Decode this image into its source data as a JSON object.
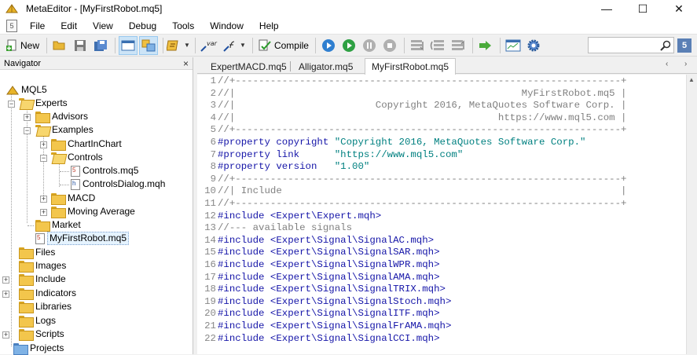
{
  "window": {
    "title": "MetaEditor - [MyFirstRobot.mq5]",
    "controls": [
      "—",
      "☐",
      "✕"
    ]
  },
  "menu": {
    "doc_icon": "5",
    "items": [
      "File",
      "Edit",
      "View",
      "Debug",
      "Tools",
      "Window",
      "Help"
    ]
  },
  "toolbar": {
    "new_label": "New",
    "compile_label": "Compile",
    "var_label": "var",
    "help_label": "5"
  },
  "navigator": {
    "title": "Navigator",
    "close": "×",
    "tree": [
      {
        "label": "MQL5",
        "icon": "mql5-root-icon"
      },
      {
        "label": "Experts",
        "icon": "folder-open-icon"
      },
      {
        "label": "Advisors",
        "icon": "folder-icon"
      },
      {
        "label": "Examples",
        "icon": "folder-open-icon"
      },
      {
        "label": "ChartInChart",
        "icon": "folder-icon"
      },
      {
        "label": "Controls",
        "icon": "folder-open-icon"
      },
      {
        "label": "Controls.mq5",
        "icon": "mq5-file-icon"
      },
      {
        "label": "ControlsDialog.mqh",
        "icon": "mqh-file-icon"
      },
      {
        "label": "MACD",
        "icon": "folder-icon"
      },
      {
        "label": "Moving Average",
        "icon": "folder-icon"
      },
      {
        "label": "Market",
        "icon": "folder-icon"
      },
      {
        "label": "MyFirstRobot.mq5",
        "icon": "mq5-file-icon"
      },
      {
        "label": "Files",
        "icon": "folder-icon"
      },
      {
        "label": "Images",
        "icon": "folder-icon"
      },
      {
        "label": "Include",
        "icon": "folder-icon"
      },
      {
        "label": "Indicators",
        "icon": "folder-icon"
      },
      {
        "label": "Libraries",
        "icon": "folder-icon"
      },
      {
        "label": "Logs",
        "icon": "folder-icon"
      },
      {
        "label": "Scripts",
        "icon": "folder-icon"
      },
      {
        "label": "Projects",
        "icon": "folder-blue-icon"
      }
    ]
  },
  "editor": {
    "tabs": [
      "ExpertMACD.mq5",
      "Alligator.mq5",
      "MyFirstRobot.mq5"
    ],
    "active_tab": "MyFirstRobot.mq5",
    "tab_nav": [
      "‹",
      "›"
    ],
    "lines": [
      {
        "n": "1",
        "text": "//+------------------------------------------------------------------+",
        "kind": "comment"
      },
      {
        "n": "2",
        "text": "//|                                                 MyFirstRobot.mq5 |",
        "kind": "comment"
      },
      {
        "n": "3",
        "text": "//|                        Copyright 2016, MetaQuotes Software Corp. |",
        "kind": "comment"
      },
      {
        "n": "4",
        "text": "//|                                             https://www.mql5.com |",
        "kind": "comment"
      },
      {
        "n": "5",
        "text": "//+------------------------------------------------------------------+",
        "kind": "comment"
      },
      {
        "n": "6",
        "kw": "#property copyright ",
        "str": "\"Copyright 2016, MetaQuotes Software Corp.\"",
        "kind": "prop"
      },
      {
        "n": "7",
        "kw": "#property link      ",
        "str": "\"https://www.mql5.com\"",
        "kind": "prop"
      },
      {
        "n": "8",
        "kw": "#property version   ",
        "str": "\"1.00\"",
        "kind": "prop"
      },
      {
        "n": "9",
        "text": "//+------------------------------------------------------------------+",
        "kind": "comment"
      },
      {
        "n": "10",
        "text": "//| Include                                                          |",
        "kind": "comment"
      },
      {
        "n": "11",
        "text": "//+------------------------------------------------------------------+",
        "kind": "comment"
      },
      {
        "n": "12",
        "kw": "#include ",
        "str": "<Expert\\Expert.mqh>",
        "kind": "include"
      },
      {
        "n": "13",
        "text": "//--- available signals",
        "kind": "comment"
      },
      {
        "n": "14",
        "kw": "#include ",
        "str": "<Expert\\Signal\\SignalAC.mqh>",
        "kind": "include"
      },
      {
        "n": "15",
        "kw": "#include ",
        "str": "<Expert\\Signal\\SignalSAR.mqh>",
        "kind": "include"
      },
      {
        "n": "16",
        "kw": "#include ",
        "str": "<Expert\\Signal\\SignalWPR.mqh>",
        "kind": "include"
      },
      {
        "n": "17",
        "kw": "#include ",
        "str": "<Expert\\Signal\\SignalAMA.mqh>",
        "kind": "include"
      },
      {
        "n": "18",
        "kw": "#include ",
        "str": "<Expert\\Signal\\SignalTRIX.mqh>",
        "kind": "include"
      },
      {
        "n": "19",
        "kw": "#include ",
        "str": "<Expert\\Signal\\SignalStoch.mqh>",
        "kind": "include"
      },
      {
        "n": "20",
        "kw": "#include ",
        "str": "<Expert\\Signal\\SignalITF.mqh>",
        "kind": "include"
      },
      {
        "n": "21",
        "kw": "#include ",
        "str": "<Expert\\Signal\\SignalFrAMA.mqh>",
        "kind": "include"
      },
      {
        "n": "22",
        "kw": "#include ",
        "str": "<Expert\\Signal\\SignalCCI.mqh>",
        "kind": "include"
      }
    ]
  },
  "colors": {
    "keyword": "#1515a8",
    "string": "#008080",
    "comment": "#808080",
    "folder": "#f3c64c"
  }
}
